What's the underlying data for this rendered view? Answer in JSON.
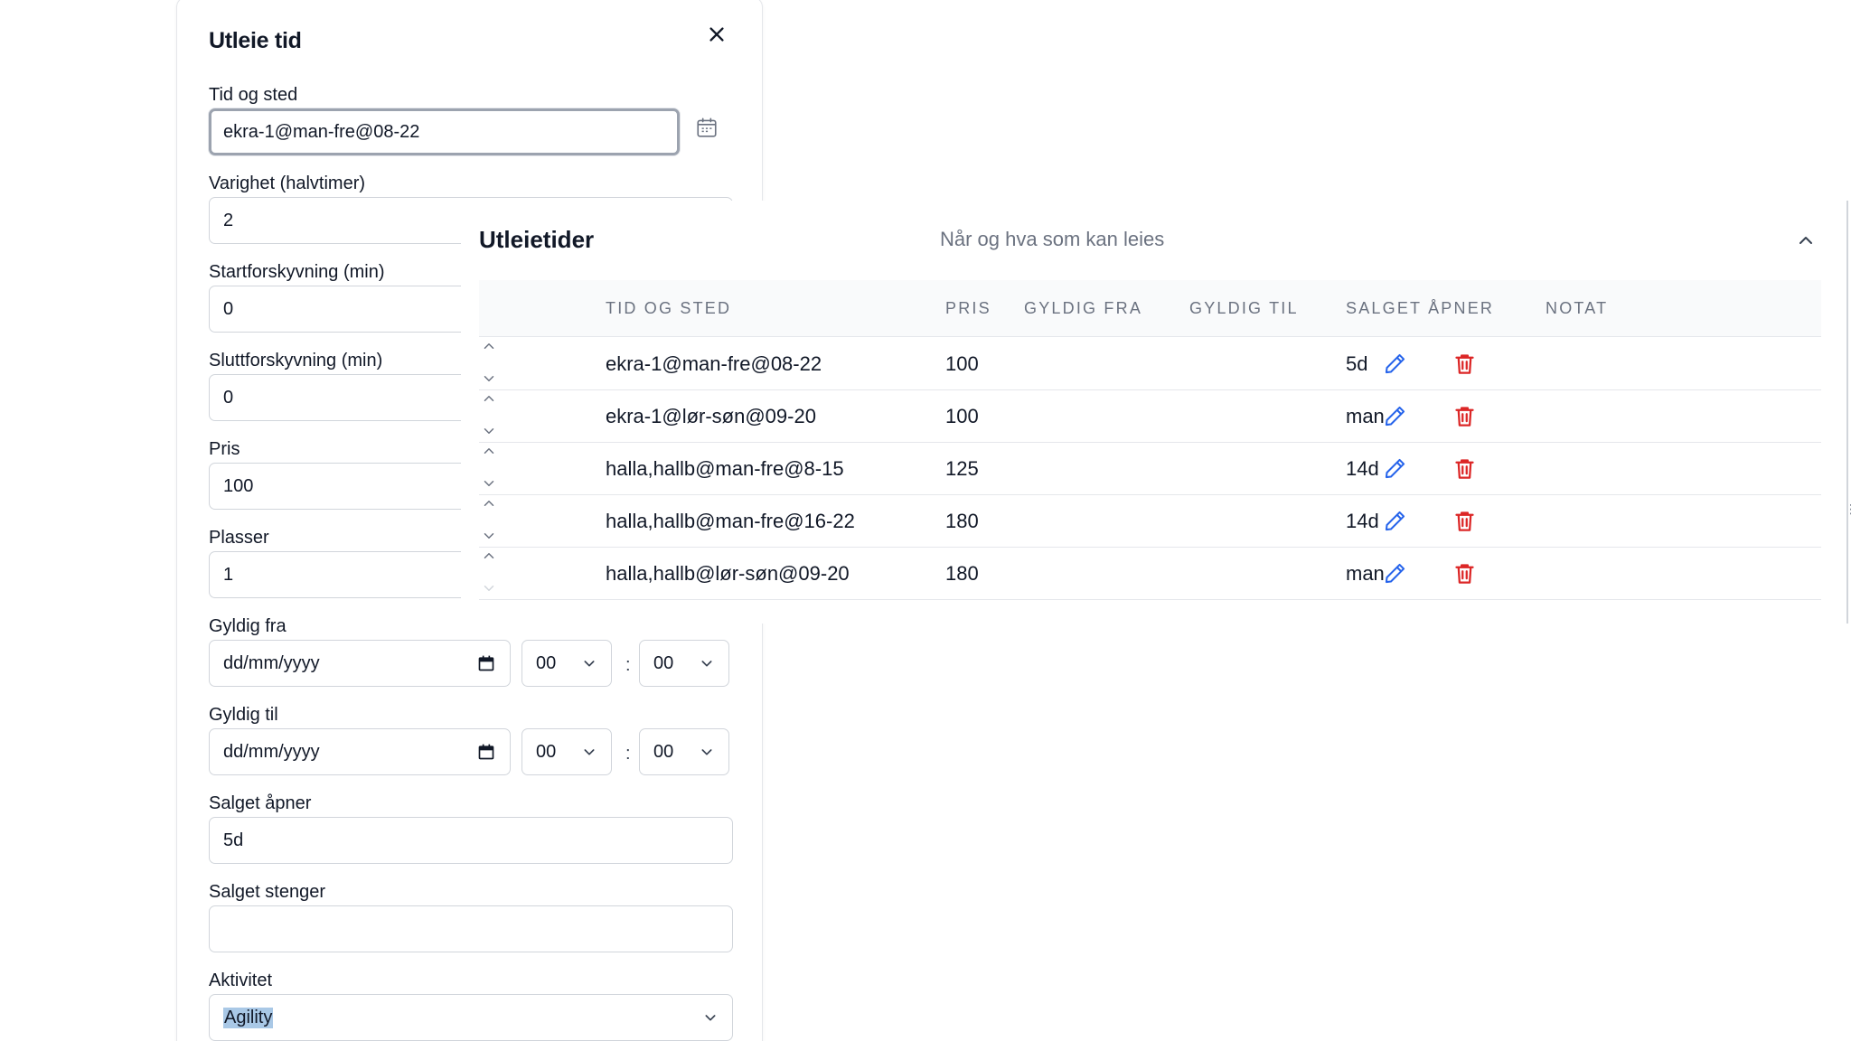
{
  "modal": {
    "title": "Utleie tid",
    "fields": {
      "tid_og_sted": {
        "label": "Tid og sted",
        "value": "ekra-1@man-fre@08-22"
      },
      "varighet": {
        "label": "Varighet (halvtimer)",
        "value": "2"
      },
      "startforskyvning": {
        "label": "Startforskyvning (min)",
        "value": "0"
      },
      "sluttforskyvning": {
        "label": "Sluttforskyvning (min)",
        "value": "0"
      },
      "pris": {
        "label": "Pris",
        "value": "100"
      },
      "plasser": {
        "label": "Plasser",
        "value": "1"
      },
      "gyldig_fra": {
        "label": "Gyldig fra",
        "date": "dd/mm/yyyy",
        "hour": "00",
        "minute": "00"
      },
      "gyldig_til": {
        "label": "Gyldig til",
        "date": "dd/mm/yyyy",
        "hour": "00",
        "minute": "00"
      },
      "salget_apner": {
        "label": "Salget åpner",
        "value": "5d"
      },
      "salget_stenger": {
        "label": "Salget stenger",
        "value": ""
      },
      "aktivitet": {
        "label": "Aktivitet",
        "value": "Agility"
      }
    },
    "time_separator": ":"
  },
  "panel": {
    "title": "Utleietider",
    "subtitle": "Når og hva som kan leies",
    "columns": [
      "Tid og sted",
      "Pris",
      "Gyldig fra",
      "Gyldig til",
      "Salget åpner",
      "Notat"
    ],
    "rows": [
      {
        "tid_og_sted": "ekra-1@man-fre@08-22",
        "pris": "100",
        "gyldig_fra": "",
        "gyldig_til": "",
        "salget_apner": "5d",
        "notat": ""
      },
      {
        "tid_og_sted": "ekra-1@lør-søn@09-20",
        "pris": "100",
        "gyldig_fra": "",
        "gyldig_til": "",
        "salget_apner": "man",
        "notat": ""
      },
      {
        "tid_og_sted": "halla,hallb@man-fre@8-15",
        "pris": "125",
        "gyldig_fra": "",
        "gyldig_til": "",
        "salget_apner": "14d",
        "notat": ""
      },
      {
        "tid_og_sted": "halla,hallb@man-fre@16-22",
        "pris": "180",
        "gyldig_fra": "",
        "gyldig_til": "",
        "salget_apner": "14d",
        "notat": ""
      },
      {
        "tid_og_sted": "halla,hallb@lør-søn@09-20",
        "pris": "180",
        "gyldig_fra": "",
        "gyldig_til": "",
        "salget_apner": "man",
        "notat": ""
      }
    ]
  },
  "colors": {
    "edit_icon": "#2563eb",
    "delete_icon": "#dc2626",
    "selection_highlight": "#a9c8e6"
  },
  "icons": {
    "close": "close-icon",
    "calendar": "calendar-icon",
    "date_picker": "calendar-icon",
    "select": "chevron-down-icon",
    "collapse": "chevron-up-icon",
    "row_up": "chevron-up-icon",
    "row_down": "chevron-down-icon",
    "edit": "pencil-icon",
    "delete": "trash-icon"
  }
}
